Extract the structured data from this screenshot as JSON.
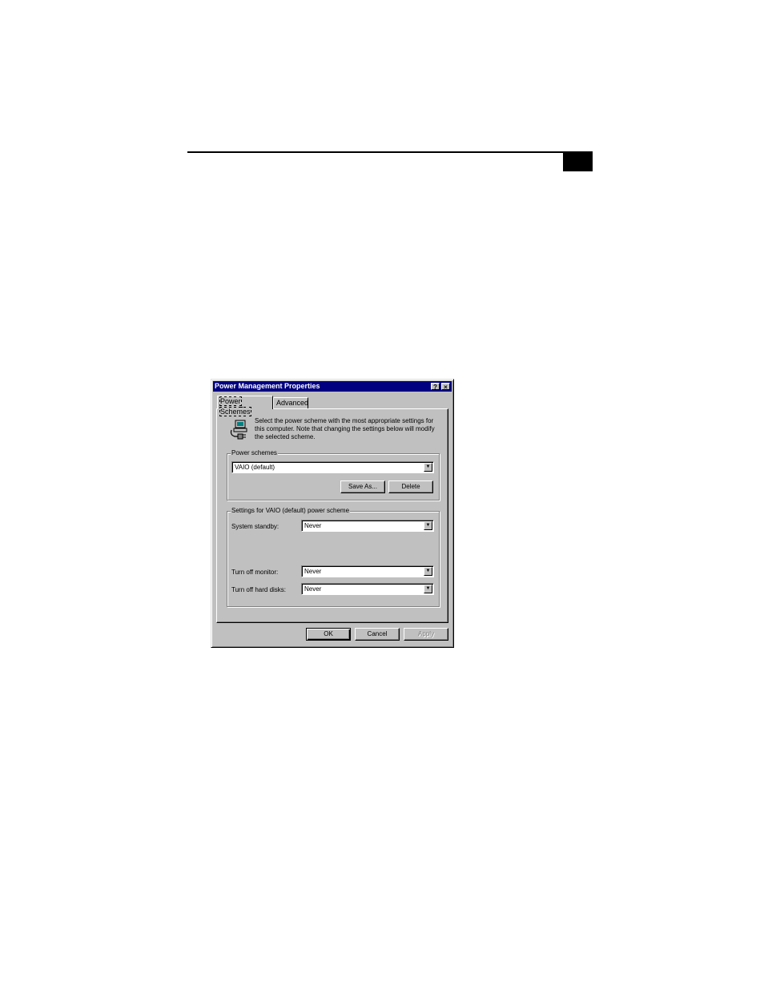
{
  "dialog": {
    "title": "Power Management Properties",
    "help_button": "?",
    "close_button": "×",
    "tabs": [
      {
        "label": "Power Schemes",
        "active": true
      },
      {
        "label": "Advanced",
        "active": false
      }
    ],
    "intro_text": "Select the power scheme with the most appropriate settings for this computer. Note that changing the settings below will modify the selected scheme.",
    "power_schemes": {
      "group_label": "Power schemes",
      "selected": "VAIO (default)",
      "save_as_label": "Save As...",
      "delete_label": "Delete"
    },
    "settings": {
      "group_label": "Settings for VAIO (default) power scheme",
      "system_standby": {
        "label": "System standby:",
        "value": "Never"
      },
      "turn_off_monitor": {
        "label": "Turn off monitor:",
        "value": "Never"
      },
      "turn_off_hard_disks": {
        "label": "Turn off hard disks:",
        "value": "Never"
      }
    },
    "footer": {
      "ok_label": "OK",
      "cancel_label": "Cancel",
      "apply_label": "Apply"
    }
  },
  "icons": {
    "power_icon": "computer-power-plug-icon",
    "dropdown_arrow": "chevron-down-icon"
  },
  "colors": {
    "titlebar": "#000080",
    "face": "#c0c0c0"
  }
}
